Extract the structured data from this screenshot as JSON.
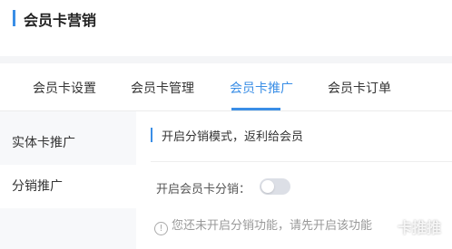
{
  "page": {
    "title": "会员卡营销"
  },
  "tabs": [
    {
      "label": "会员卡设置"
    },
    {
      "label": "会员卡管理"
    },
    {
      "label": "会员卡推广",
      "active": true
    },
    {
      "label": "会员卡订单"
    }
  ],
  "sidebar": {
    "items": [
      {
        "label": "实体卡推广"
      },
      {
        "label": "分销推广",
        "active": true
      }
    ]
  },
  "main": {
    "section_title": "开启分销模式，返利给会员",
    "toggle_label": "开启会员卡分销：",
    "toggle_on": false,
    "hint_icon": "!",
    "hint": "您还未开启分销功能，请先开启该功能"
  },
  "watermark": "卡推推",
  "colors": {
    "accent": "#3a8ee6",
    "sidebar_bg": "#f7f8fa",
    "toggle_off": "#dcdfe6"
  }
}
